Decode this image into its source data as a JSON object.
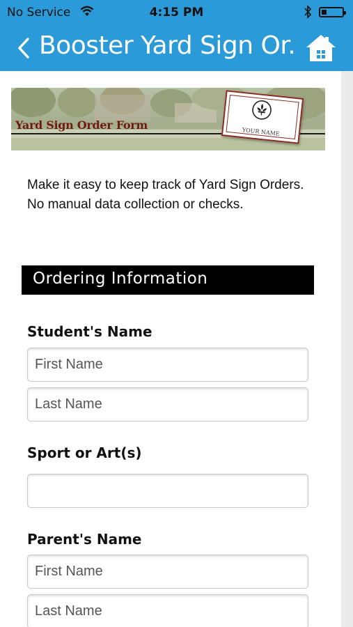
{
  "status_bar": {
    "carrier": "No Service",
    "time": "4:15 PM",
    "battery_level": 0.25,
    "icons": [
      "wifi-icon",
      "bluetooth-icon",
      "battery-icon"
    ]
  },
  "nav": {
    "title": "Booster Yard Sign Or...",
    "back_icon": "chevron-left-icon",
    "home_icon": "home-icon",
    "accent_color": "#2a9bd8"
  },
  "banner": {
    "title": "Yard Sign Order Form",
    "card_name": "YOUR NAME",
    "card_icon": "fleur-de-lis-icon"
  },
  "intro_text": "Make it easy to keep track of Yard Sign Orders. No manual data collection or checks.",
  "section": {
    "title": "Ordering Information"
  },
  "fields": {
    "student_name": {
      "label": "Student's Name",
      "first_placeholder": "First Name",
      "last_placeholder": "Last Name",
      "first_value": "",
      "last_value": ""
    },
    "sport": {
      "label": "Sport or Art(s)",
      "placeholder": "",
      "value": ""
    },
    "parent_name": {
      "label": "Parent's Name",
      "first_placeholder": "First Name",
      "last_placeholder": "Last Name",
      "first_value": "",
      "last_value": ""
    }
  }
}
